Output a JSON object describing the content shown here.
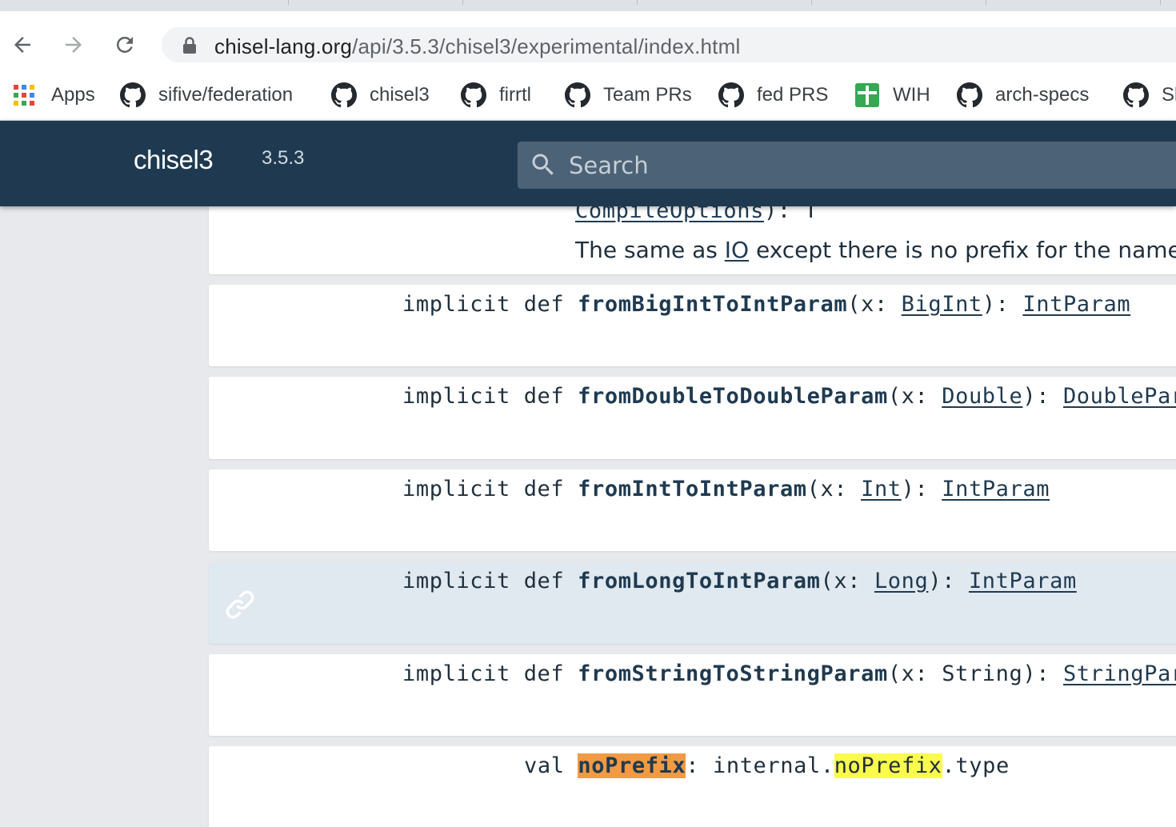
{
  "browser": {
    "url_domain": "chisel-lang.org",
    "url_path": "/api/3.5.3/chisel3/experimental/index.html",
    "bookmarks": [
      "Apps",
      "sifive/federation",
      "chisel3",
      "firrtl",
      "Team PRs",
      "fed PRS",
      "WIH",
      "arch-specs",
      "Sl"
    ]
  },
  "header": {
    "title": "chisel3",
    "version": "3.5.3",
    "search_placeholder": "Search"
  },
  "members": [
    {
      "partial_sig": "CompileOptions",
      "partial_tail": "): T",
      "desc_pre": "The same as ",
      "desc_link": "IO",
      "desc_post": " except there is no prefix for the name of t"
    },
    {
      "prefix": "implicit def ",
      "name": "fromBigIntToIntParam",
      "params_open": "(x: ",
      "param_type": "BigInt",
      "params_close": "): ",
      "ret": "IntParam"
    },
    {
      "prefix": "implicit def ",
      "name": "fromDoubleToDoubleParam",
      "params_open": "(x: ",
      "param_type": "Double",
      "params_close": "): ",
      "ret": "DoublePar"
    },
    {
      "prefix": "implicit def ",
      "name": "fromIntToIntParam",
      "params_open": "(x: ",
      "param_type": "Int",
      "params_close": "): ",
      "ret": "IntParam"
    },
    {
      "prefix": "implicit def ",
      "name": "fromLongToIntParam",
      "params_open": "(x: ",
      "param_type": "Long",
      "params_close": "): ",
      "ret": "IntParam"
    },
    {
      "prefix": "implicit def ",
      "name": "fromStringToStringParam",
      "params_open": "(x: ",
      "param_type": "String",
      "params_close": "): ",
      "ret": "StringPar"
    },
    {
      "prefix": "val ",
      "name": "noPrefix",
      "colon": ": ",
      "type_pre": "internal.",
      "type_hl": "noPrefix",
      "type_post": ".type"
    }
  ],
  "colors": {
    "header_bg": "#1f3a50",
    "search_bg": "#4c6277",
    "selected_row": "#e0e8f0",
    "highlight_current": "#f29a43",
    "highlight_other": "#fbfb4e"
  },
  "icons": [
    "back-arrow-icon",
    "forward-arrow-icon",
    "reload-icon",
    "lock-icon",
    "apps-grid-icon",
    "github-icon",
    "sheets-icon",
    "search-icon",
    "permalink-icon"
  ]
}
